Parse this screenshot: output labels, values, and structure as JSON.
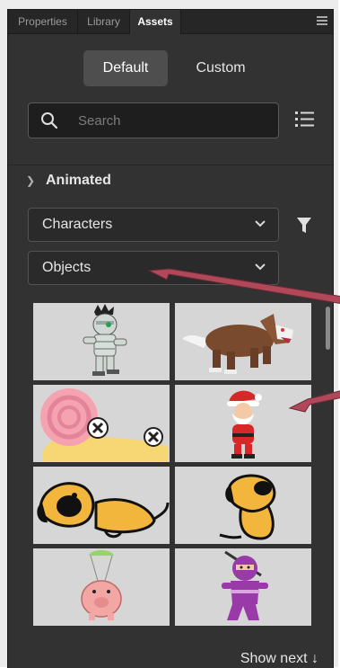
{
  "tabs": [
    {
      "label": "Properties",
      "active": false
    },
    {
      "label": "Library",
      "active": false
    },
    {
      "label": "Assets",
      "active": true
    }
  ],
  "segments": {
    "default_label": "Default",
    "custom_label": "Custom",
    "selected": "Default"
  },
  "search": {
    "placeholder": "Search",
    "value": ""
  },
  "section": {
    "title": "Animated",
    "expanded": true
  },
  "dropdowns": {
    "first": "Characters",
    "second": "Objects"
  },
  "assets": [
    {
      "name": "mummy-character",
      "icon": "mummy"
    },
    {
      "name": "werewolf-character",
      "icon": "werewolf"
    },
    {
      "name": "snail-character",
      "icon": "snail"
    },
    {
      "name": "santa-character",
      "icon": "santa"
    },
    {
      "name": "dog-lying-character",
      "icon": "dog-lying"
    },
    {
      "name": "dog-sitting-character",
      "icon": "dog-sitting"
    },
    {
      "name": "parachute-pig-character",
      "icon": "pig"
    },
    {
      "name": "ninja-character",
      "icon": "ninja"
    }
  ],
  "footer": {
    "show_next_label": "Show next"
  },
  "colors": {
    "panel": "#323232",
    "tabbar": "#262626",
    "annotation_arrow": "#b0485a",
    "thumb_bg": "#d6d6d6"
  }
}
